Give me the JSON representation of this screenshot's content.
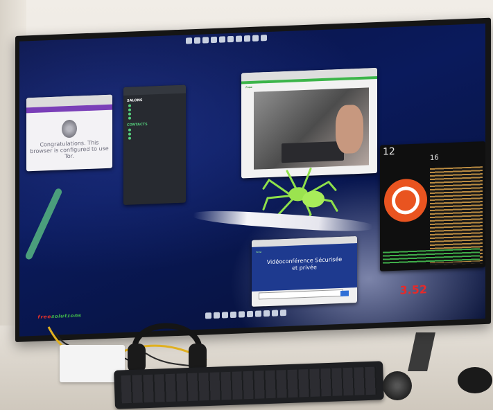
{
  "tor_window": {
    "heading": "Congratulations. This browser is configured to use Tor."
  },
  "chat_window": {
    "section_rooms": "SALONS",
    "section_contacts": "CONTACTS"
  },
  "visio_window": {
    "headline": "Vidéoconférence Sécurisée et privée"
  },
  "screen_overlay": {
    "counter": "3.52"
  },
  "colors": {
    "ubuntu_orange": "#e95420",
    "brand_red": "#e3322b",
    "brand_green": "#3fb24a",
    "counter_red": "#e52a2a"
  },
  "icons": [
    "tor-onion-icon",
    "ubuntu-logo-icon",
    "spider-icon",
    "headphones-icon"
  ]
}
